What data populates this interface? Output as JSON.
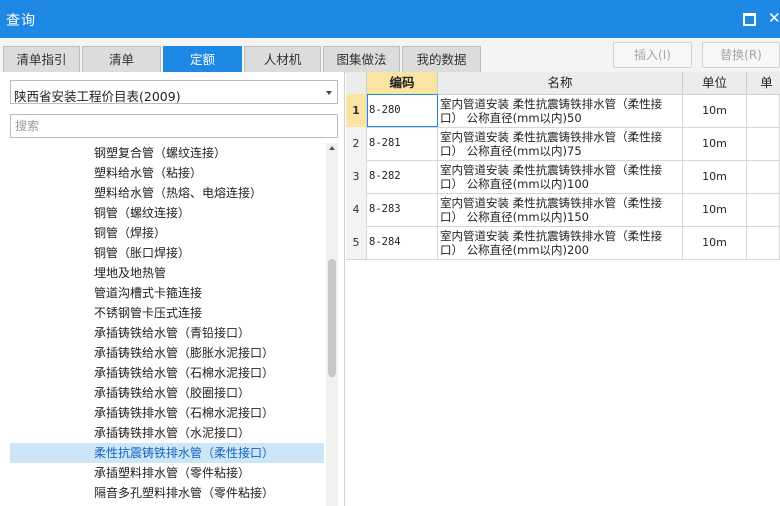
{
  "window": {
    "title": "查询"
  },
  "tabs": [
    {
      "label": "清单指引"
    },
    {
      "label": "清单"
    },
    {
      "label": "定额"
    },
    {
      "label": "人材机"
    },
    {
      "label": "图集做法"
    },
    {
      "label": "我的数据"
    }
  ],
  "toolbar": {
    "insert_label": "插入(I)",
    "replace_label": "替换(R)"
  },
  "left": {
    "selected_catalog": "陕西省安装工程价目表(2009)",
    "search_placeholder": "搜索",
    "tree_items": [
      "钢塑复合管（螺纹连接）",
      "塑料给水管（粘接）",
      "塑料给水管（热熔、电熔连接）",
      "铜管（螺纹连接）",
      "铜管（焊接）",
      "铜管（胀口焊接）",
      "埋地及地热管",
      "管道沟槽式卡箍连接",
      "不锈钢管卡压式连接",
      "承插铸铁给水管（青铅接口）",
      "承插铸铁给水管（膨胀水泥接口）",
      "承插铸铁给水管（石棉水泥接口）",
      "承插铸铁给水管（胶圈接口）",
      "承插铸铁排水管（石棉水泥接口）",
      "承插铸铁排水管（水泥接口）",
      "柔性抗震铸铁排水管（柔性接口）",
      "承插塑料排水管（零件粘接）",
      "隔音多孔塑料排水管（零件粘接）"
    ],
    "selected_index": 15
  },
  "grid": {
    "headers": {
      "code": "编码",
      "name": "名称",
      "unit": "单位",
      "extra": "单"
    },
    "rows": [
      {
        "num": "1",
        "code": "8-280",
        "name1": "室内管道安装 柔性抗震铸铁排水管（柔性接",
        "name2": "口） 公称直径(mm以内)50",
        "unit": "10m"
      },
      {
        "num": "2",
        "code": "8-281",
        "name1": "室内管道安装 柔性抗震铸铁排水管（柔性接",
        "name2": "口） 公称直径(mm以内)75",
        "unit": "10m"
      },
      {
        "num": "3",
        "code": "8-282",
        "name1": "室内管道安装 柔性抗震铸铁排水管（柔性接",
        "name2": "口） 公称直径(mm以内)100",
        "unit": "10m"
      },
      {
        "num": "4",
        "code": "8-283",
        "name1": "室内管道安装 柔性抗震铸铁排水管（柔性接",
        "name2": "口） 公称直径(mm以内)150",
        "unit": "10m"
      },
      {
        "num": "5",
        "code": "8-284",
        "name1": "室内管道安装 柔性抗震铸铁排水管（柔性接",
        "name2": "口） 公称直径(mm以内)200",
        "unit": "10m"
      }
    ]
  },
  "colors": {
    "accent": "#1e88e5",
    "selected_bg": "#cce6f8",
    "code_header": "#fbe4a2"
  }
}
